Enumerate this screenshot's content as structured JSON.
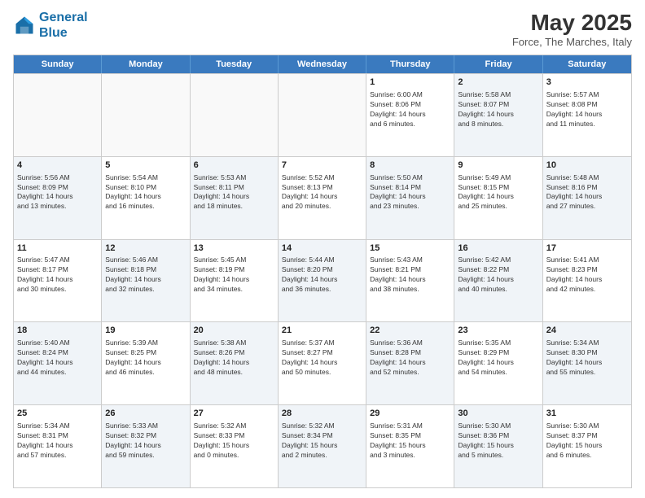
{
  "logo": {
    "line1": "General",
    "line2": "Blue"
  },
  "title": "May 2025",
  "subtitle": "Force, The Marches, Italy",
  "header_days": [
    "Sunday",
    "Monday",
    "Tuesday",
    "Wednesday",
    "Thursday",
    "Friday",
    "Saturday"
  ],
  "rows": [
    [
      {
        "day": "",
        "info": "",
        "empty": true
      },
      {
        "day": "",
        "info": "",
        "empty": true
      },
      {
        "day": "",
        "info": "",
        "empty": true
      },
      {
        "day": "",
        "info": "",
        "empty": true
      },
      {
        "day": "1",
        "info": "Sunrise: 6:00 AM\nSunset: 8:06 PM\nDaylight: 14 hours\nand 6 minutes.",
        "shaded": false
      },
      {
        "day": "2",
        "info": "Sunrise: 5:58 AM\nSunset: 8:07 PM\nDaylight: 14 hours\nand 8 minutes.",
        "shaded": true
      },
      {
        "day": "3",
        "info": "Sunrise: 5:57 AM\nSunset: 8:08 PM\nDaylight: 14 hours\nand 11 minutes.",
        "shaded": false
      }
    ],
    [
      {
        "day": "4",
        "info": "Sunrise: 5:56 AM\nSunset: 8:09 PM\nDaylight: 14 hours\nand 13 minutes.",
        "shaded": true
      },
      {
        "day": "5",
        "info": "Sunrise: 5:54 AM\nSunset: 8:10 PM\nDaylight: 14 hours\nand 16 minutes.",
        "shaded": false
      },
      {
        "day": "6",
        "info": "Sunrise: 5:53 AM\nSunset: 8:11 PM\nDaylight: 14 hours\nand 18 minutes.",
        "shaded": true
      },
      {
        "day": "7",
        "info": "Sunrise: 5:52 AM\nSunset: 8:13 PM\nDaylight: 14 hours\nand 20 minutes.",
        "shaded": false
      },
      {
        "day": "8",
        "info": "Sunrise: 5:50 AM\nSunset: 8:14 PM\nDaylight: 14 hours\nand 23 minutes.",
        "shaded": true
      },
      {
        "day": "9",
        "info": "Sunrise: 5:49 AM\nSunset: 8:15 PM\nDaylight: 14 hours\nand 25 minutes.",
        "shaded": false
      },
      {
        "day": "10",
        "info": "Sunrise: 5:48 AM\nSunset: 8:16 PM\nDaylight: 14 hours\nand 27 minutes.",
        "shaded": true
      }
    ],
    [
      {
        "day": "11",
        "info": "Sunrise: 5:47 AM\nSunset: 8:17 PM\nDaylight: 14 hours\nand 30 minutes.",
        "shaded": false
      },
      {
        "day": "12",
        "info": "Sunrise: 5:46 AM\nSunset: 8:18 PM\nDaylight: 14 hours\nand 32 minutes.",
        "shaded": true
      },
      {
        "day": "13",
        "info": "Sunrise: 5:45 AM\nSunset: 8:19 PM\nDaylight: 14 hours\nand 34 minutes.",
        "shaded": false
      },
      {
        "day": "14",
        "info": "Sunrise: 5:44 AM\nSunset: 8:20 PM\nDaylight: 14 hours\nand 36 minutes.",
        "shaded": true
      },
      {
        "day": "15",
        "info": "Sunrise: 5:43 AM\nSunset: 8:21 PM\nDaylight: 14 hours\nand 38 minutes.",
        "shaded": false
      },
      {
        "day": "16",
        "info": "Sunrise: 5:42 AM\nSunset: 8:22 PM\nDaylight: 14 hours\nand 40 minutes.",
        "shaded": true
      },
      {
        "day": "17",
        "info": "Sunrise: 5:41 AM\nSunset: 8:23 PM\nDaylight: 14 hours\nand 42 minutes.",
        "shaded": false
      }
    ],
    [
      {
        "day": "18",
        "info": "Sunrise: 5:40 AM\nSunset: 8:24 PM\nDaylight: 14 hours\nand 44 minutes.",
        "shaded": true
      },
      {
        "day": "19",
        "info": "Sunrise: 5:39 AM\nSunset: 8:25 PM\nDaylight: 14 hours\nand 46 minutes.",
        "shaded": false
      },
      {
        "day": "20",
        "info": "Sunrise: 5:38 AM\nSunset: 8:26 PM\nDaylight: 14 hours\nand 48 minutes.",
        "shaded": true
      },
      {
        "day": "21",
        "info": "Sunrise: 5:37 AM\nSunset: 8:27 PM\nDaylight: 14 hours\nand 50 minutes.",
        "shaded": false
      },
      {
        "day": "22",
        "info": "Sunrise: 5:36 AM\nSunset: 8:28 PM\nDaylight: 14 hours\nand 52 minutes.",
        "shaded": true
      },
      {
        "day": "23",
        "info": "Sunrise: 5:35 AM\nSunset: 8:29 PM\nDaylight: 14 hours\nand 54 minutes.",
        "shaded": false
      },
      {
        "day": "24",
        "info": "Sunrise: 5:34 AM\nSunset: 8:30 PM\nDaylight: 14 hours\nand 55 minutes.",
        "shaded": true
      }
    ],
    [
      {
        "day": "25",
        "info": "Sunrise: 5:34 AM\nSunset: 8:31 PM\nDaylight: 14 hours\nand 57 minutes.",
        "shaded": false
      },
      {
        "day": "26",
        "info": "Sunrise: 5:33 AM\nSunset: 8:32 PM\nDaylight: 14 hours\nand 59 minutes.",
        "shaded": true
      },
      {
        "day": "27",
        "info": "Sunrise: 5:32 AM\nSunset: 8:33 PM\nDaylight: 15 hours\nand 0 minutes.",
        "shaded": false
      },
      {
        "day": "28",
        "info": "Sunrise: 5:32 AM\nSunset: 8:34 PM\nDaylight: 15 hours\nand 2 minutes.",
        "shaded": true
      },
      {
        "day": "29",
        "info": "Sunrise: 5:31 AM\nSunset: 8:35 PM\nDaylight: 15 hours\nand 3 minutes.",
        "shaded": false
      },
      {
        "day": "30",
        "info": "Sunrise: 5:30 AM\nSunset: 8:36 PM\nDaylight: 15 hours\nand 5 minutes.",
        "shaded": true
      },
      {
        "day": "31",
        "info": "Sunrise: 5:30 AM\nSunset: 8:37 PM\nDaylight: 15 hours\nand 6 minutes.",
        "shaded": false
      }
    ]
  ]
}
